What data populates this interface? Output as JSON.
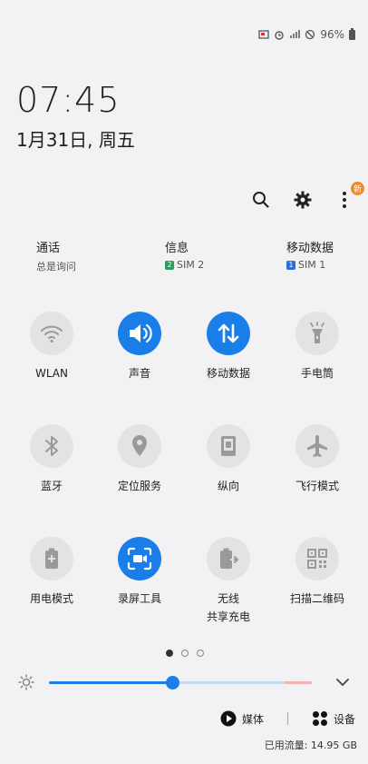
{
  "status": {
    "battery": "96%"
  },
  "clock": {
    "time": "07:45",
    "date": "1月31日, 周五"
  },
  "toolbar": {
    "badge": "新"
  },
  "quick": [
    {
      "title": "通话",
      "sub": "总是询问",
      "sim": "",
      "sim_color": ""
    },
    {
      "title": "信息",
      "sub": "SIM 2",
      "sim": "2",
      "sim_color": "#2e9c5b"
    },
    {
      "title": "移动数据",
      "sub": "SIM 1",
      "sim": "1",
      "sim_color": "#2a6fd1"
    }
  ],
  "tiles": [
    {
      "label": "WLAN",
      "icon": "wifi-icon",
      "on": false
    },
    {
      "label": "声音",
      "icon": "volume-icon",
      "on": true
    },
    {
      "label": "移动数据",
      "icon": "mobile-data-icon",
      "on": true
    },
    {
      "label": "手电筒",
      "icon": "flashlight-icon",
      "on": false
    },
    {
      "label": "蓝牙",
      "icon": "bluetooth-icon",
      "on": false
    },
    {
      "label": "定位服务",
      "icon": "location-icon",
      "on": false
    },
    {
      "label": "纵向",
      "icon": "portrait-icon",
      "on": false
    },
    {
      "label": "飞行模式",
      "icon": "airplane-icon",
      "on": false
    },
    {
      "label": "用电模式",
      "icon": "power-mode-icon",
      "on": false
    },
    {
      "label": "录屏工具",
      "icon": "screen-record-icon",
      "on": true
    },
    {
      "label": "无线\n共享充电",
      "icon": "wireless-share-charge-icon",
      "on": false
    },
    {
      "label": "扫描二维码",
      "icon": "qr-scan-icon",
      "on": false
    }
  ],
  "pager": {
    "count": 3,
    "active": 0
  },
  "brightness": {
    "level": 0.47
  },
  "media": {
    "media_label": "媒体",
    "device_label": "设备"
  },
  "data_usage": "已用流量: 14.95 GB",
  "colors": {
    "accent": "#1a7ee8",
    "tile_off": "#e3e3e6",
    "background": "#f2f2f4"
  }
}
